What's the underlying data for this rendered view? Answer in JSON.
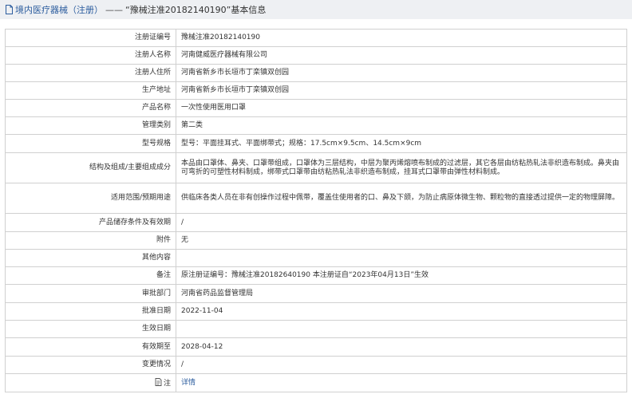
{
  "header": {
    "title": "境内医疗器械（注册）",
    "separator": "——",
    "subtitle": "“豫械注准20182140190”基本信息"
  },
  "rows": [
    {
      "name": "reg-cert-number",
      "label": "注册证编号",
      "value": "豫械注准20182140190",
      "h": 22
    },
    {
      "name": "registrant-name",
      "label": "注册人名称",
      "value": "河南健威医疗器械有限公司",
      "h": 22
    },
    {
      "name": "registrant-address",
      "label": "注册人住所",
      "value": "河南省新乡市长垣市丁栾镇双创园",
      "h": 22
    },
    {
      "name": "production-address",
      "label": "生产地址",
      "value": "河南省新乡市长垣市丁栾镇双创园",
      "h": 22
    },
    {
      "name": "product-name",
      "label": "产品名称",
      "value": "一次性使用医用口罩",
      "h": 22
    },
    {
      "name": "management-class",
      "label": "管理类别",
      "value": "第二类",
      "h": 22
    },
    {
      "name": "model-spec",
      "label": "型号规格",
      "value": "型号：平面挂耳式、平面绑带式；规格：17.5cm×9.5cm、14.5cm×9cm",
      "h": 23
    },
    {
      "name": "structure-composition",
      "label": "结构及组成/主要组成成分",
      "value": "本品由口罩体、鼻夹、口罩带组成，口罩体为三层结构，中层为聚丙烯熔喷布制成的过滤层，其它各层由纺粘热轧法非织造布制成。鼻夹由可弯折的可塑性材料制成，绑带式口罩带由纺粘热轧法非织造布制成，挂耳式口罩带由弹性材料制成。",
      "h": 38
    },
    {
      "name": "intended-use",
      "label": "适用范围/预期用途",
      "value": "供临床各类人员在非有创操作过程中佩带，覆盖住使用者的口、鼻及下颌，为防止病原体微生物、颗粒物的直接透过提供一定的物理屏障。",
      "h": 38
    },
    {
      "name": "storage-conditions",
      "label": "产品储存条件及有效期",
      "value": "/",
      "h": 23
    },
    {
      "name": "attachment",
      "label": "附件",
      "value": "无",
      "h": 22
    },
    {
      "name": "other-content",
      "label": "其他内容",
      "value": "",
      "h": 22
    },
    {
      "name": "remarks",
      "label": "备注",
      "value": "原注册证编号：豫械注准20182640190 本注册证自“2023年04月13日”生效",
      "h": 22
    },
    {
      "name": "approval-dept",
      "label": "审批部门",
      "value": "河南省药品监督管理局",
      "h": 23
    },
    {
      "name": "approval-date",
      "label": "批准日期",
      "value": "2022-11-04",
      "h": 22
    },
    {
      "name": "effective-date",
      "label": "生效日期",
      "value": "",
      "h": 22
    },
    {
      "name": "expiry-date",
      "label": "有效期至",
      "value": "2028-04-12",
      "h": 23
    },
    {
      "name": "change-status",
      "label": "变更情况",
      "value": "/",
      "h": 22
    },
    {
      "name": "notes",
      "label": "注",
      "value": "详情",
      "h": 23,
      "link": true,
      "icon": true
    }
  ]
}
